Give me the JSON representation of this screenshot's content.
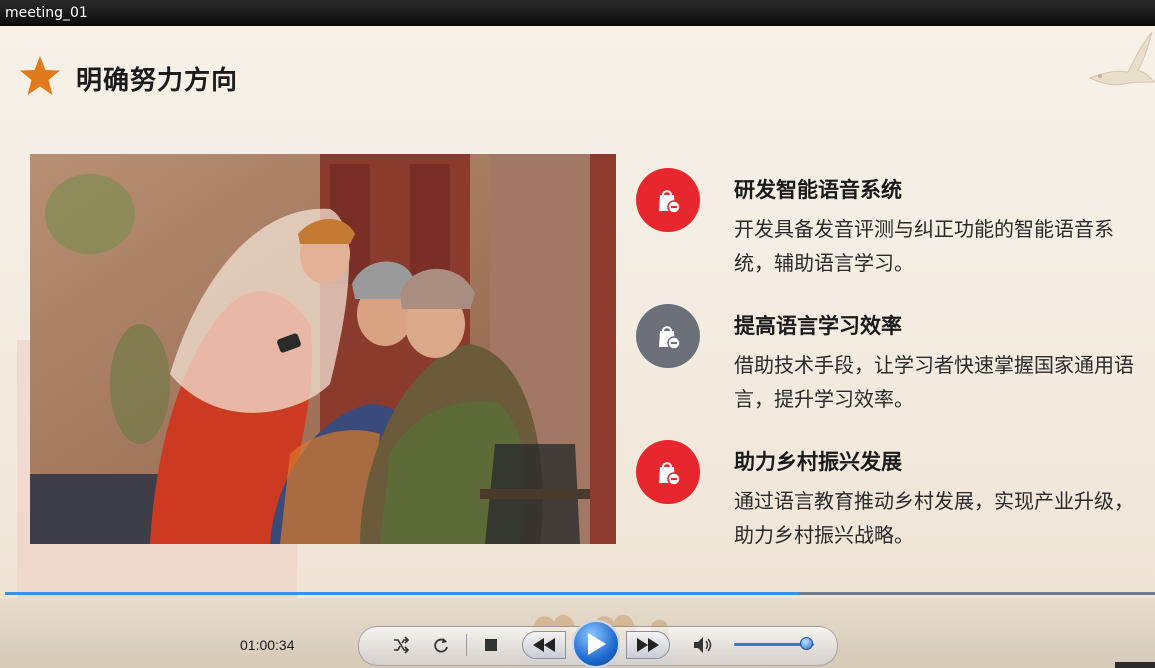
{
  "window": {
    "title": "meeting_01"
  },
  "slide": {
    "title": "明确努力方向",
    "accent_color": "#e8262d",
    "points": [
      {
        "heading": "研发智能语音系统",
        "description": "开发具备发音评测与纠正功能的智能语音系统，辅助语言学习。",
        "icon": "shopping-bag-icon",
        "color": "#e8262d"
      },
      {
        "heading": "提高语言学习效率",
        "description": "借助技术手段，让学习者快速掌握国家通用语言，提升学习效率。",
        "icon": "shopping-bag-icon",
        "color": "#6b7079"
      },
      {
        "heading": "助力乡村振兴发展",
        "description": "通过语言教育推动乡村发展，实现产业升级，助力乡村振兴战略。",
        "icon": "shopping-bag-icon",
        "color": "#e8262d"
      }
    ]
  },
  "player": {
    "elapsed": "01:00:34",
    "progress_fraction": 0.69,
    "volume_fraction": 0.85,
    "buttons": [
      "shuffle-icon",
      "repeat-icon",
      "stop-icon",
      "rewind-icon",
      "play-icon",
      "fast-forward-icon",
      "volume-icon"
    ]
  }
}
